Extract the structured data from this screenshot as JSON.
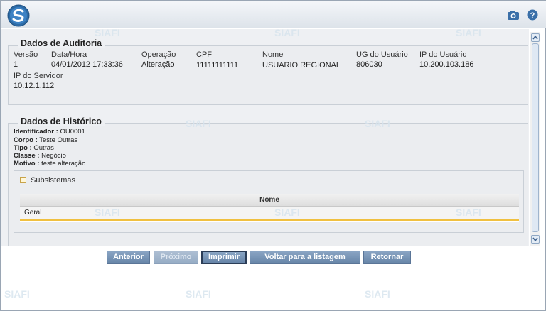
{
  "auditoria": {
    "title": "Dados de Auditoria",
    "columns": [
      {
        "label": "Versão",
        "value": "1"
      },
      {
        "label": "Data/Hora",
        "value": "04/01/2012 17:33:36"
      },
      {
        "label": "Operação",
        "value": "Alteração"
      },
      {
        "label": "CPF",
        "value": "11111111111"
      },
      {
        "label": "Nome",
        "value": "USUARIO REGIONAL"
      },
      {
        "label": "UG do Usuário",
        "value": "806030"
      },
      {
        "label": "IP do Usuário",
        "value": "10.200.103.186"
      }
    ],
    "ip_servidor": {
      "label": "IP do Servidor",
      "value": "10.12.1.112"
    }
  },
  "historico": {
    "title": "Dados de Histórico",
    "fields": [
      {
        "label": "Identificador :",
        "value": "OU0001"
      },
      {
        "label": "Corpo :",
        "value": "Teste Outras"
      },
      {
        "label": "Tipo :",
        "value": "Outras"
      },
      {
        "label": "Classe :",
        "value": "Negócio"
      },
      {
        "label": "Motivo :",
        "value": "teste alteração"
      }
    ],
    "subsistemas": {
      "title": "Subsistemas",
      "column_header": "Nome",
      "rows": [
        "Geral"
      ]
    }
  },
  "buttons": {
    "anterior": "Anterior",
    "proximo": "Próximo",
    "imprimir": "Imprimir",
    "voltar": "Voltar para a listagem",
    "retornar": "Retornar"
  },
  "watermark": "SIAFI",
  "colors": {
    "button": "#6f8cae",
    "highlight_row": "#f0c040"
  }
}
